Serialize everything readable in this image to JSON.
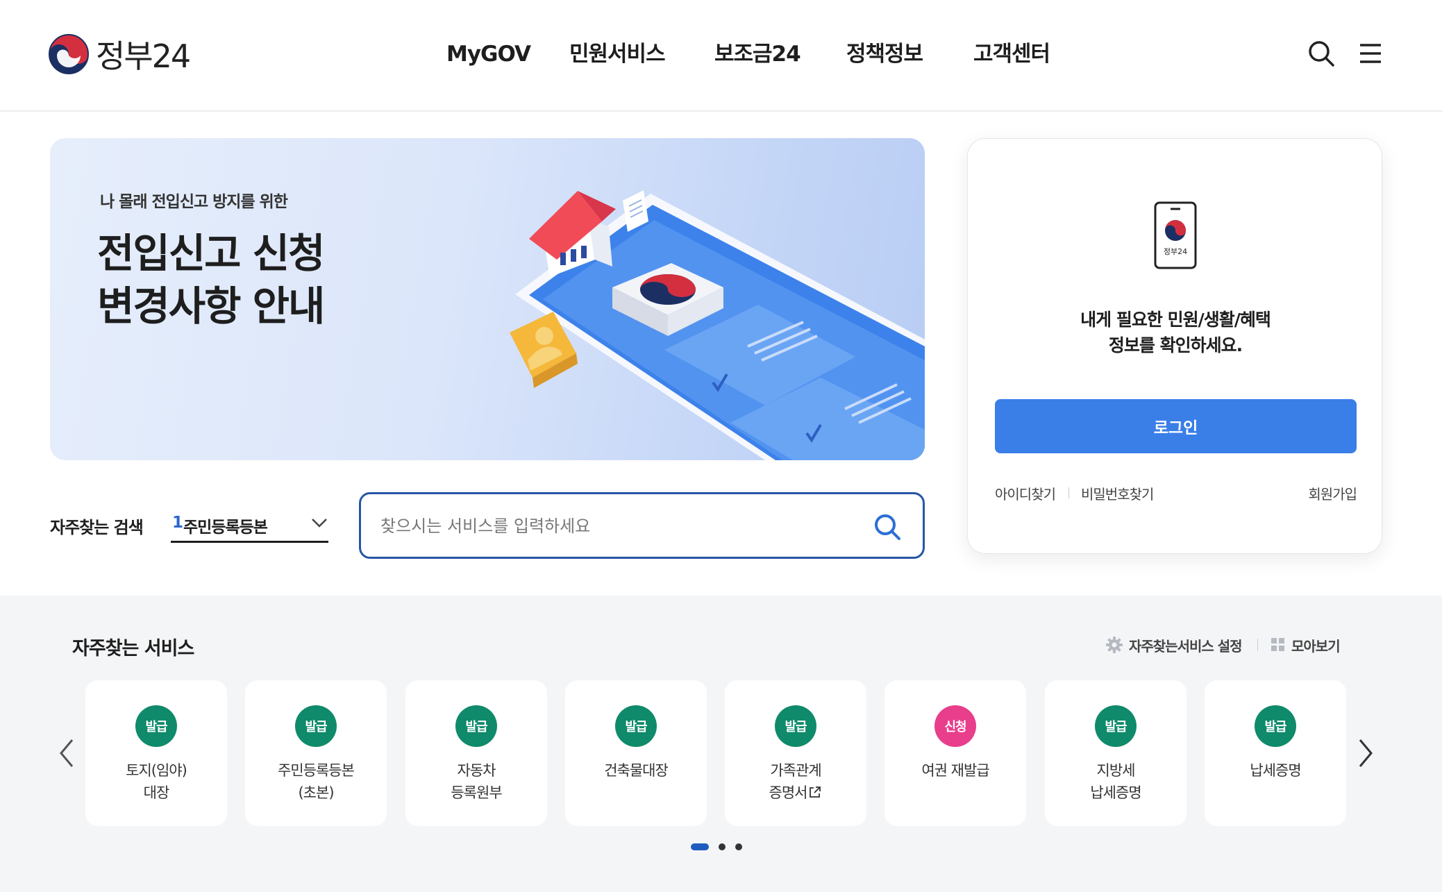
{
  "header": {
    "logo_text": "정부24",
    "nav": [
      "MyGOV",
      "민원서비스",
      "보조금24",
      "정책정보",
      "고객센터"
    ],
    "search_icon": "search-icon",
    "menu_icon": "hamburger-menu-icon"
  },
  "banner": {
    "subtitle": "나 몰래 전입신고 방지를 위한",
    "title_line1": "전입신고 신청",
    "title_line2": "변경사항 안내"
  },
  "frequent_search": {
    "label": "자주찾는 검색",
    "rank": "1",
    "selected": "주민등록등본"
  },
  "search": {
    "placeholder": "찾으시는 서비스를 입력하세요"
  },
  "login": {
    "phone_label": "정부24",
    "message_line1": "내게 필요한 민원/생활/혜택",
    "message_line2": "정보를 확인하세요.",
    "button": "로그인",
    "find_id": "아이디찾기",
    "find_password": "비밀번호찾기",
    "signup": "회원가입"
  },
  "services": {
    "title": "자주찾는 서비스",
    "settings_label": "자주찾는서비스 설정",
    "view_all_label": "모아보기",
    "items": [
      {
        "badge": "발급",
        "label": "토지(임야)\n대장",
        "type": "issue"
      },
      {
        "badge": "발급",
        "label": "주민등록등본\n(초본)",
        "type": "issue"
      },
      {
        "badge": "발급",
        "label": "자동차\n등록원부",
        "type": "issue"
      },
      {
        "badge": "발급",
        "label": "건축물대장",
        "type": "issue"
      },
      {
        "badge": "발급",
        "label": "가족관계\n증명서",
        "type": "issue",
        "external": true
      },
      {
        "badge": "신청",
        "label": "여권 재발급",
        "type": "apply"
      },
      {
        "badge": "발급",
        "label": "지방세\n납세증명",
        "type": "issue"
      },
      {
        "badge": "발급",
        "label": "납세증명",
        "type": "issue"
      }
    ],
    "pagination": {
      "total": 3,
      "active": 1
    }
  },
  "colors": {
    "primary_blue": "#3a7ee8",
    "search_border": "#2456a6",
    "issue_badge": "#0f8a6a",
    "apply_badge": "#e83e8c",
    "section_bg": "#f4f5f7"
  }
}
